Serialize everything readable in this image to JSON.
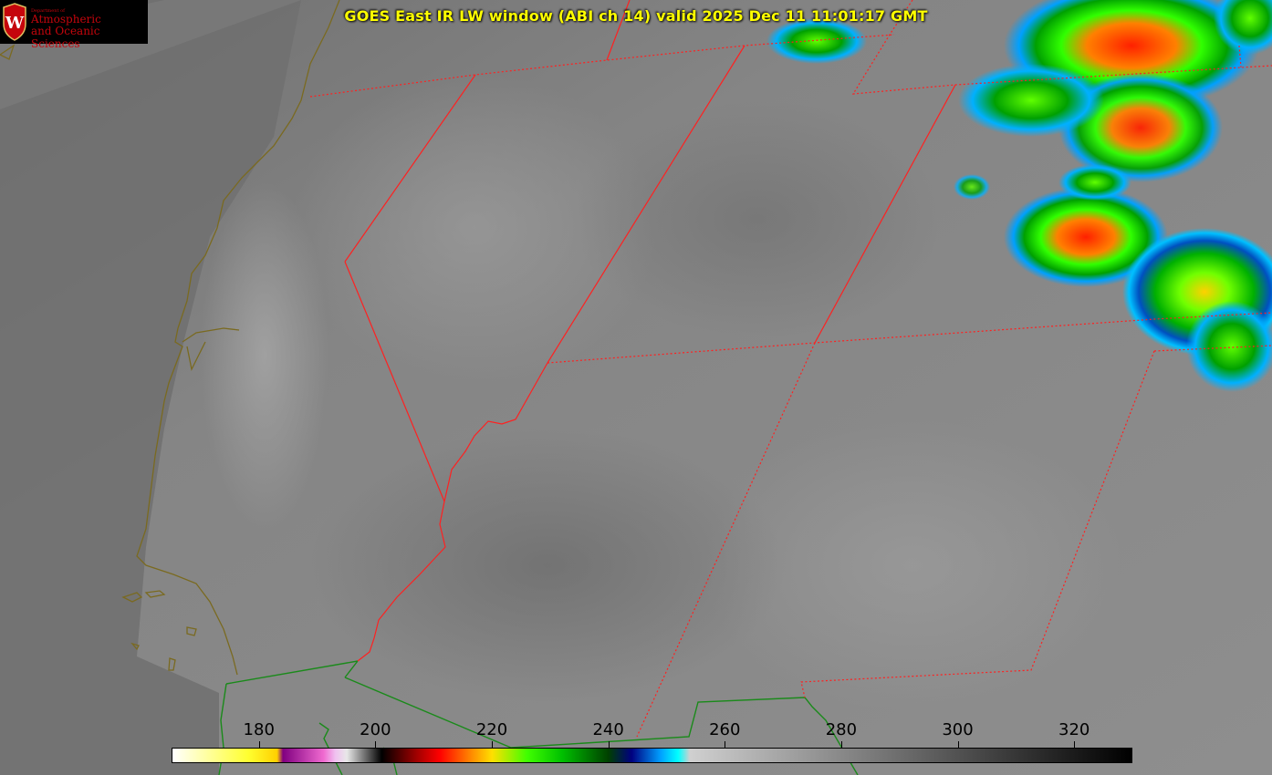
{
  "title": "GOES East IR LW window (ABI ch 14) valid 2025 Dec 11 11:01:17 GMT",
  "logo": {
    "dept": "Department of",
    "line1": "Atmospheric",
    "line2": "and Oceanic Sciences",
    "crest_letter": "W"
  },
  "colorbar": {
    "min": 165,
    "max": 330,
    "ticks": [
      "180",
      "200",
      "220",
      "240",
      "260",
      "280",
      "300",
      "320"
    ],
    "tick_values": [
      180,
      200,
      220,
      240,
      260,
      280,
      300,
      320
    ],
    "unit_note": "",
    "stops": [
      {
        "v": 165,
        "c": "#ffffff"
      },
      {
        "v": 178,
        "c": "#ffff30"
      },
      {
        "v": 183,
        "c": "#ffd000"
      },
      {
        "v": 184,
        "c": "#800080"
      },
      {
        "v": 191,
        "c": "#f06ad0"
      },
      {
        "v": 193,
        "c": "#f0c0f0"
      },
      {
        "v": 195,
        "c": "#e8e8e8"
      },
      {
        "v": 201,
        "c": "#000000"
      },
      {
        "v": 207,
        "c": "#a00000"
      },
      {
        "v": 211,
        "c": "#ff0000"
      },
      {
        "v": 216,
        "c": "#ff8000"
      },
      {
        "v": 220,
        "c": "#ffe000"
      },
      {
        "v": 226,
        "c": "#40ff00"
      },
      {
        "v": 232,
        "c": "#00c000"
      },
      {
        "v": 240,
        "c": "#004000"
      },
      {
        "v": 244,
        "c": "#000080"
      },
      {
        "v": 249,
        "c": "#00a0ff"
      },
      {
        "v": 252,
        "c": "#00ffff"
      },
      {
        "v": 254,
        "c": "#d0d0d0"
      },
      {
        "v": 330,
        "c": "#000000"
      }
    ]
  },
  "colors": {
    "coastline": "#7a6a20",
    "border": "#1a8a1a",
    "state_line": "#ff2020",
    "title": "#ffff00"
  }
}
